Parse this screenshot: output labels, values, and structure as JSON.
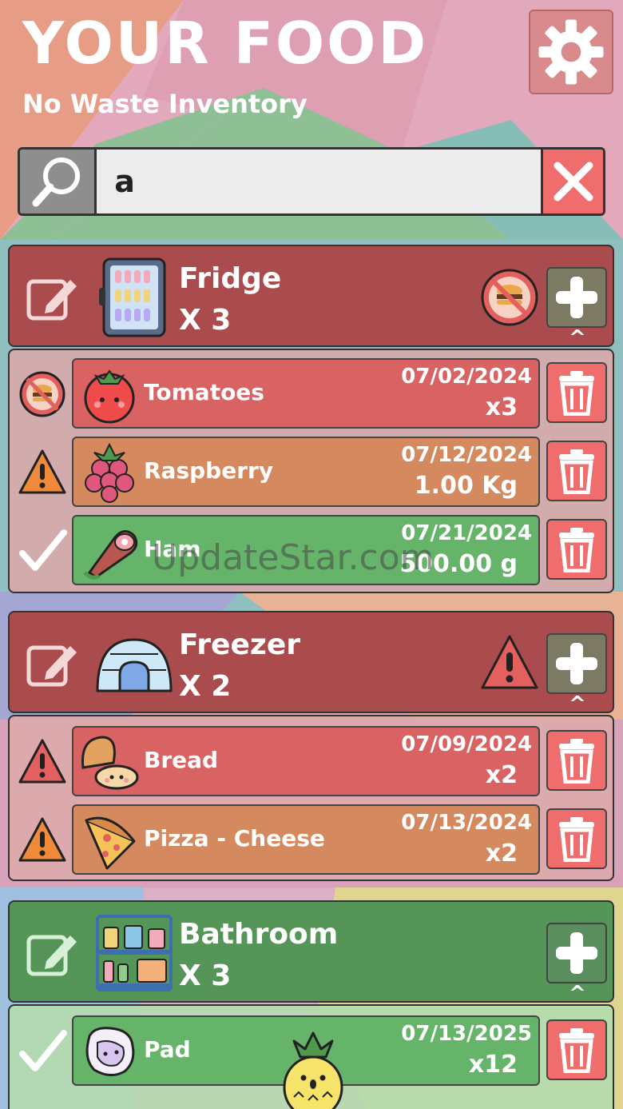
{
  "header": {
    "title": "YOUR FOOD",
    "subtitle": "No Waste Inventory",
    "settings_icon": "gear-icon"
  },
  "search": {
    "value": "a",
    "search_icon": "magnifier-icon",
    "clear_icon": "x-icon"
  },
  "colors": {
    "section_red": "#aa4b4e",
    "section_green": "#559558",
    "item_expired": "#d96263",
    "item_warning": "#d48a5e",
    "item_ok": "#66b46a",
    "delete": "#f06d6d"
  },
  "sections": [
    {
      "name": "Fridge",
      "count": "X 3",
      "icon": "fridge-icon",
      "status_icon": "no-food-icon",
      "caret": "^",
      "items": [
        {
          "status_icon": "no-food-icon",
          "icon": "tomato-icon",
          "name": "Tomatoes",
          "date": "07/02/2024",
          "qty": "x3",
          "state": "expired"
        },
        {
          "status_icon": "warning-icon",
          "icon": "raspberry-icon",
          "name": "Raspberry",
          "date": "07/12/2024",
          "qty": "1.00 Kg",
          "state": "warning"
        },
        {
          "status_icon": "check-icon",
          "icon": "ham-icon",
          "name": "Ham",
          "date": "07/21/2024",
          "qty": "500.00 g",
          "state": "ok"
        }
      ]
    },
    {
      "name": "Freezer",
      "count": "X 2",
      "icon": "igloo-icon",
      "status_icon": "warning-icon",
      "caret": "^",
      "items": [
        {
          "status_icon": "warning-icon",
          "icon": "bread-icon",
          "name": "Bread",
          "date": "07/09/2024",
          "qty": "x2",
          "state": "expired"
        },
        {
          "status_icon": "warning-icon",
          "icon": "pizza-icon",
          "name": "Pizza - Cheese",
          "date": "07/13/2024",
          "qty": "x2",
          "state": "warning"
        }
      ]
    },
    {
      "name": "Bathroom",
      "count": "X 3",
      "icon": "shelf-icon",
      "caret": "^",
      "items": [
        {
          "status_icon": "check-icon",
          "icon": "pad-icon",
          "name": "Pad",
          "date": "07/13/2025",
          "qty": "x12",
          "state": "ok"
        }
      ]
    }
  ],
  "watermark": "UpdateStar.com"
}
